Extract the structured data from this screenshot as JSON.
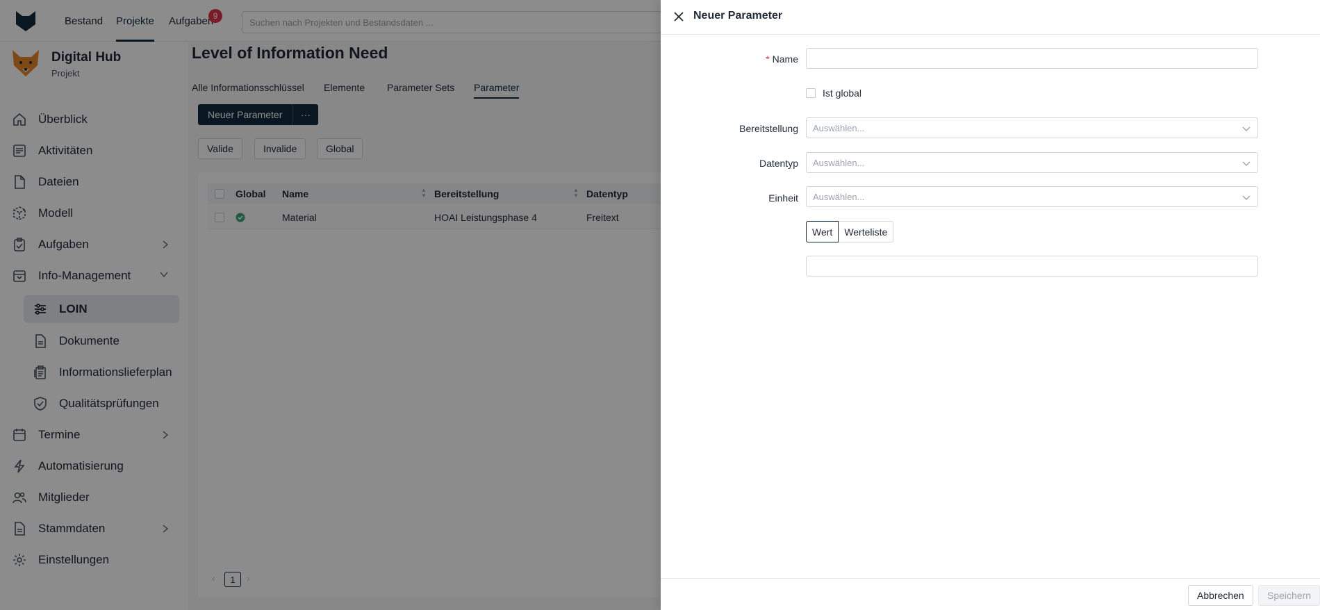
{
  "topbar": {
    "nav": [
      "Bestand",
      "Projekte",
      "Aufgaben"
    ],
    "active_nav": "Projekte",
    "tasks_count": "9",
    "search_placeholder": "Suchen nach Projekten und Bestandsdaten ..."
  },
  "project": {
    "title": "Digital Hub",
    "subtitle": "Projekt"
  },
  "sidebar": {
    "items": [
      {
        "label": "Überblick",
        "icon": "home-icon"
      },
      {
        "label": "Aktivitäten",
        "icon": "activity-icon"
      },
      {
        "label": "Dateien",
        "icon": "file-icon"
      },
      {
        "label": "Modell",
        "icon": "cube-icon"
      },
      {
        "label": "Aufgaben",
        "icon": "task-icon"
      },
      {
        "label": "Info-Management",
        "icon": "inbox-icon"
      },
      {
        "label": "Termine",
        "icon": "calendar-icon"
      },
      {
        "label": "Automatisierung",
        "icon": "lightning-icon"
      },
      {
        "label": "Mitglieder",
        "icon": "users-icon"
      },
      {
        "label": "Stammdaten",
        "icon": "document-icon"
      },
      {
        "label": "Einstellungen",
        "icon": "gear-icon"
      }
    ],
    "subitems": [
      {
        "label": "LOIN",
        "icon": "sliders-icon"
      },
      {
        "label": "Dokumente",
        "icon": "document-icon"
      },
      {
        "label": "Informationslieferplan",
        "icon": "clipboard-icon"
      },
      {
        "label": "Qualitätsprüfungen",
        "icon": "shield-check-icon"
      }
    ]
  },
  "main": {
    "title": "Level of Information Need",
    "tabs": [
      "Alle Informationsschlüssel",
      "Elemente",
      "Parameter Sets",
      "Parameter"
    ],
    "active_tab": "Parameter",
    "new_button": "Neuer Parameter",
    "more_button": "···",
    "filters": [
      "Valide",
      "Invalide",
      "Global"
    ],
    "table": {
      "columns": [
        "Global",
        "Name",
        "Bereitstellung",
        "Datentyp"
      ],
      "rows": [
        {
          "global": true,
          "name": "Material",
          "bereitstellung": "HOAI Leistungsphase 4",
          "datentyp": "Freitext"
        }
      ]
    },
    "pagination": {
      "page": "1",
      "prev": "‹",
      "next": "›"
    }
  },
  "drawer": {
    "title": "Neuer Parameter",
    "fields": {
      "name_label": "Name",
      "required_mark": "*",
      "global_label": "Ist global",
      "bereitstellung_label": "Bereitstellung",
      "datentyp_label": "Datentyp",
      "einheit_label": "Einheit",
      "select_placeholder": "Auswählen..."
    },
    "value_modes": [
      "Wert",
      "Werteliste"
    ],
    "active_mode": "Wert",
    "footer": {
      "cancel": "Abbrechen",
      "save": "Speichern"
    }
  }
}
